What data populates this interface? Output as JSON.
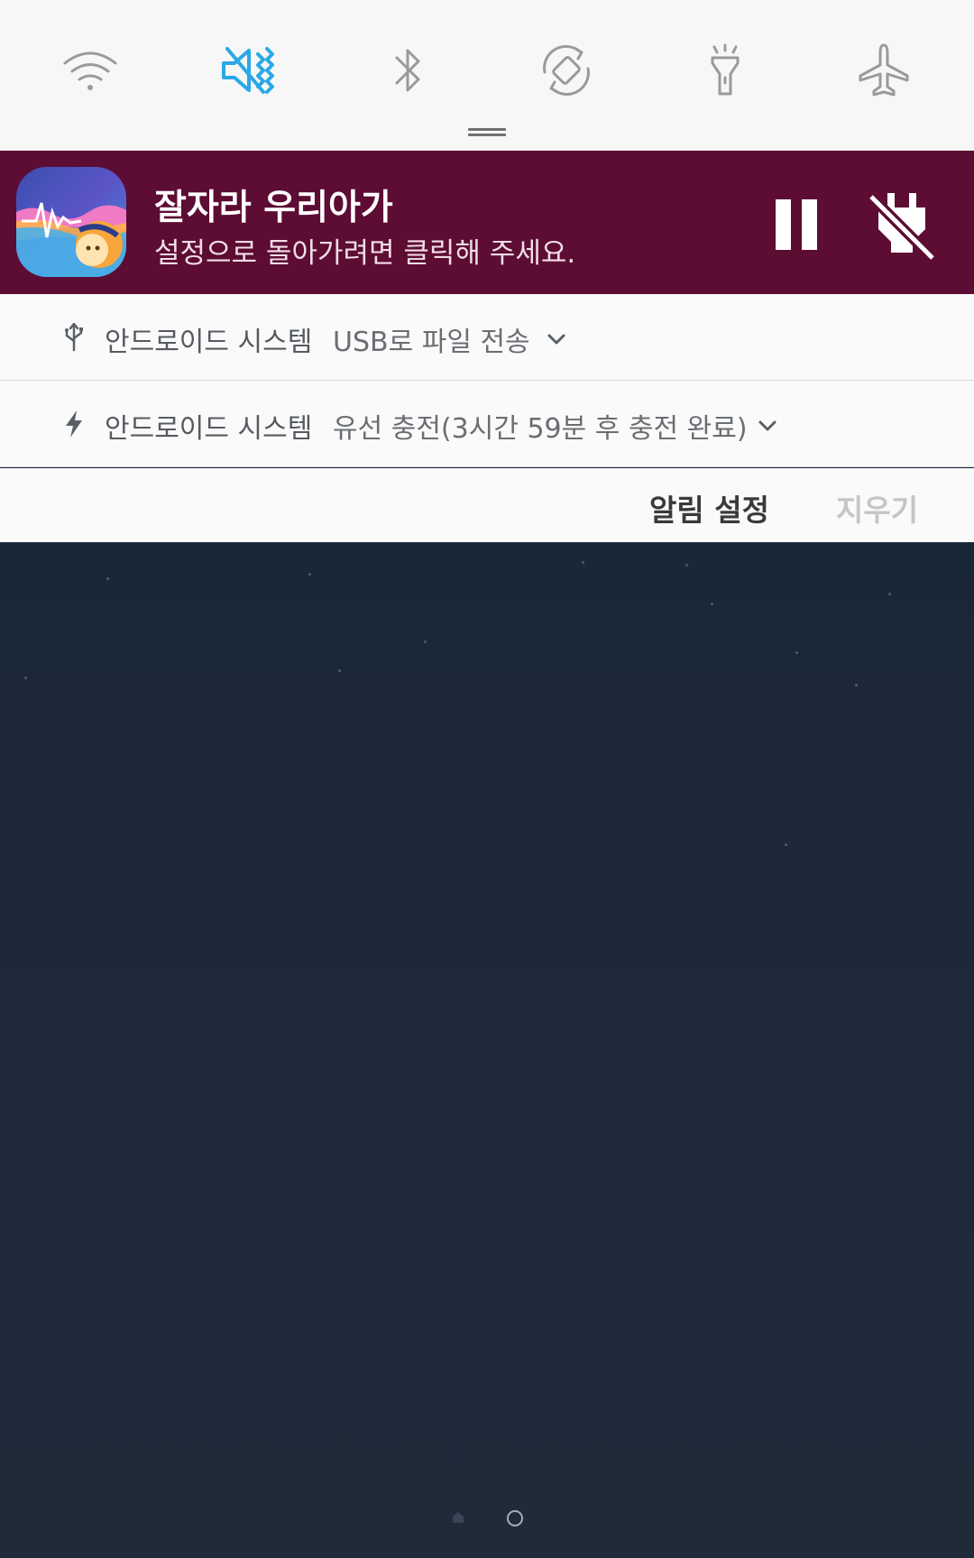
{
  "quick_settings": {
    "icons": [
      "wifi-icon",
      "mute-vibrate-icon",
      "bluetooth-icon",
      "auto-rotate-icon",
      "flashlight-icon",
      "airplane-mode-icon"
    ],
    "active_color": "#2aa8e6",
    "inactive_color": "#9a9a9a"
  },
  "media_notification": {
    "title": "잘자라 우리아가",
    "subtitle": "설정으로 돌아가려면 클릭해 주세요.",
    "background": "#5d0c34"
  },
  "system_notifications": [
    {
      "icon": "usb-icon",
      "app": "안드로이드 시스템",
      "message": "USB로 파일 전송"
    },
    {
      "icon": "charging-bolt-icon",
      "app": "안드로이드 시스템",
      "message": "유선 충전(3시간 59분 후 충전 완료)"
    }
  ],
  "actions": {
    "settings_label": "알림 설정",
    "clear_label": "지우기"
  }
}
